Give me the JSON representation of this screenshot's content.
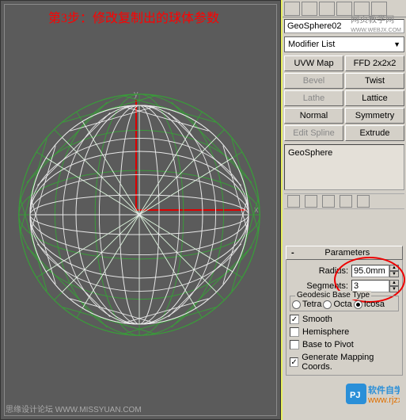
{
  "annotation": "第3步：修改复制出的球体参数",
  "axis": {
    "x": "x",
    "y": "y"
  },
  "watermark_left": "思缘设计论坛  WWW.MISSYUAN.COM",
  "watermark_right1": "网页教学网",
  "watermark_right2": "WWW.WEBJX.COM",
  "watermark_bottom": "软件自学网 www.rjzxw.com",
  "object_name": "GeoSphere02",
  "modifier_dropdown": "Modifier List",
  "modifier_buttons": [
    "UVW Map",
    "FFD 2x2x2",
    "Bevel",
    "Twist",
    "Lathe",
    "Lattice",
    "Normal",
    "Symmetry",
    "Edit Spline",
    "Extrude"
  ],
  "modifier_disabled": [
    2,
    4,
    8
  ],
  "stack_item": "GeoSphere",
  "rollout": {
    "title": "Parameters",
    "radius_label": "Radius:",
    "radius_value": "95.0mm",
    "segments_label": "Segments:",
    "segments_value": "3",
    "geodesic_label": "Geodesic Base Type",
    "radios": [
      "Tetra",
      "Octa",
      "Icosa"
    ],
    "selected_radio": 2,
    "checks": [
      {
        "label": "Smooth",
        "checked": true
      },
      {
        "label": "Hemisphere",
        "checked": false
      },
      {
        "label": "Base to Pivot",
        "checked": false
      },
      {
        "label": "Generate Mapping Coords.",
        "checked": true
      }
    ]
  }
}
